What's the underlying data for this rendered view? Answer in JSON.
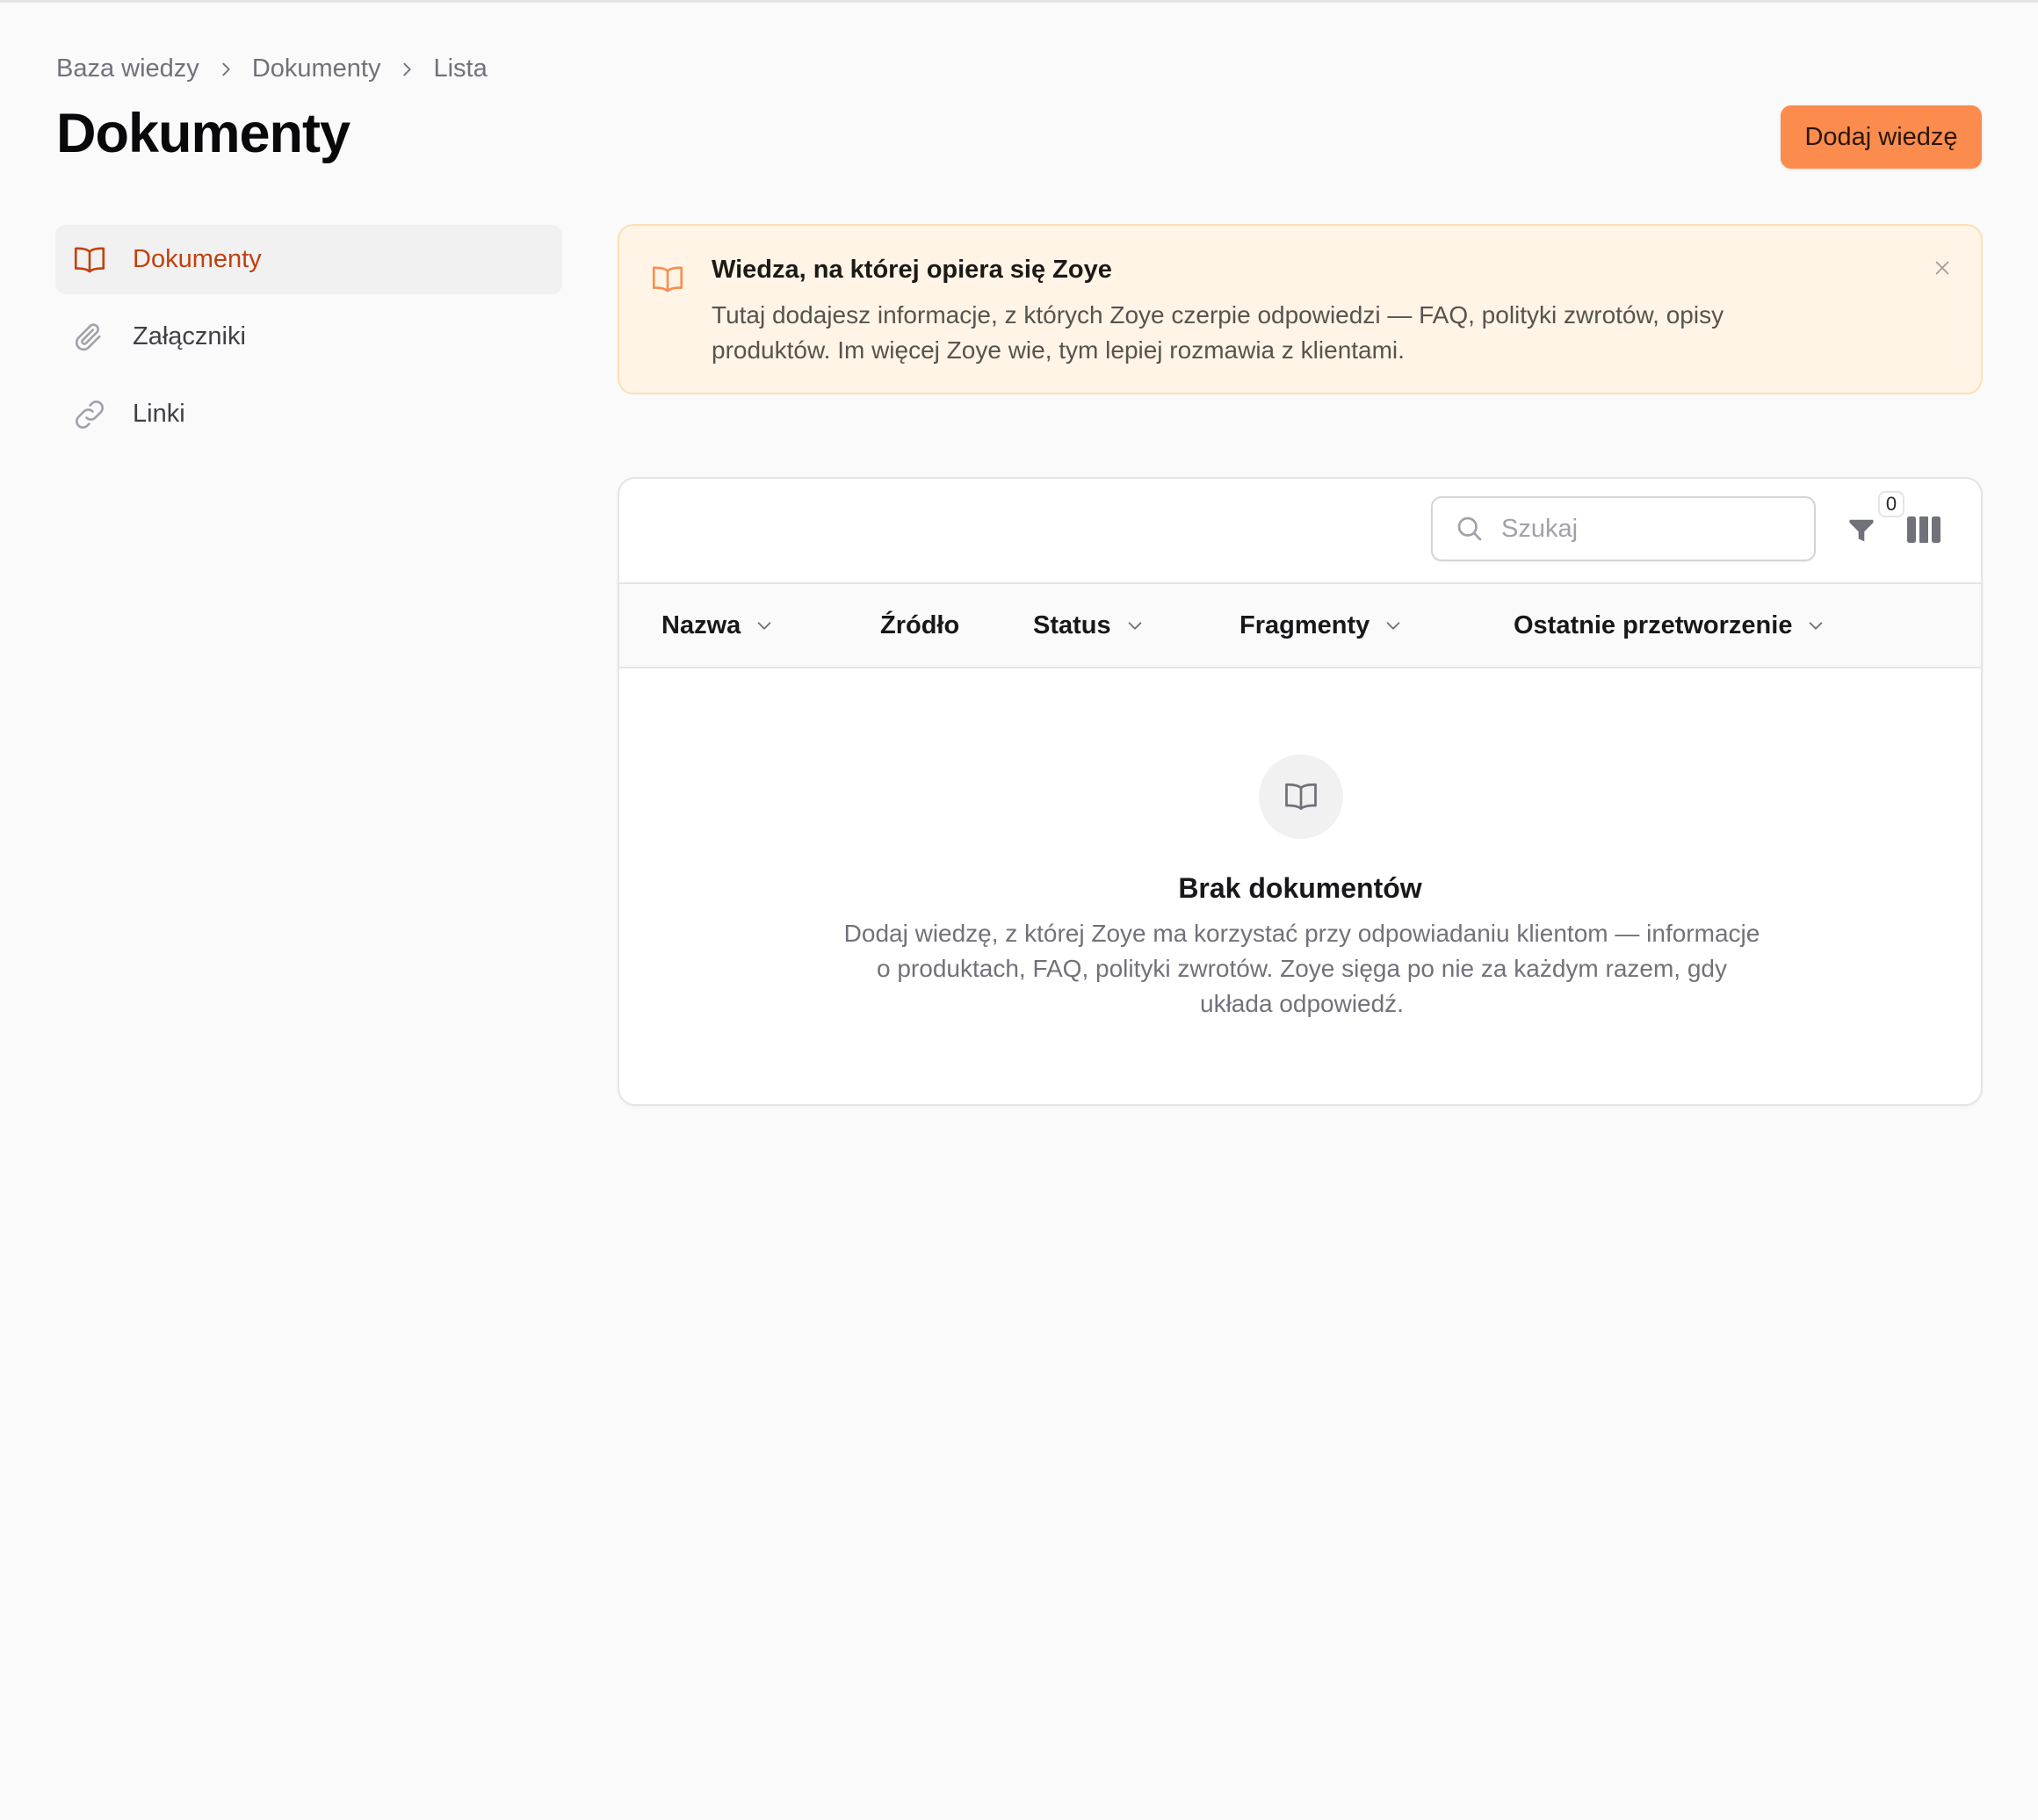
{
  "breadcrumb": [
    "Baza wiedzy",
    "Dokumenty",
    "Lista"
  ],
  "page_title": "Dokumenty",
  "add_button_label": "Dodaj wiedzę",
  "sidebar": {
    "items": [
      {
        "label": "Dokumenty",
        "icon": "book-open-icon",
        "active": true
      },
      {
        "label": "Załączniki",
        "icon": "paperclip-icon",
        "active": false
      },
      {
        "label": "Linki",
        "icon": "link-icon",
        "active": false
      }
    ]
  },
  "banner": {
    "title": "Wiedza, na której opiera się Zoye",
    "text": "Tutaj dodajesz informacje, z których Zoye czerpie odpowiedzi — FAQ, polityki zwrotów, opisy produktów. Im więcej Zoye wie, tym lepiej rozmawia z klientami.",
    "icon": "book-open-icon"
  },
  "table": {
    "search_placeholder": "Szukaj",
    "search_value": "",
    "filter_count": "0",
    "columns": [
      {
        "label": "Nazwa",
        "sortable": true
      },
      {
        "label": "Źródło",
        "sortable": false
      },
      {
        "label": "Status",
        "sortable": true
      },
      {
        "label": "Fragmenty",
        "sortable": true
      },
      {
        "label": "Ostatnie przetworzenie",
        "sortable": true
      }
    ],
    "rows": [],
    "empty_state": {
      "title": "Brak dokumentów",
      "text": "Dodaj wiedzę, z której Zoye ma korzystać przy odpowiadaniu klientom — informacje o produktach, FAQ, polityki zwrotów. Zoye sięga po nie za każdym razem, gdy układa odpowiedź.",
      "icon": "book-open-icon"
    }
  },
  "colors": {
    "accent": "#fb8c4e",
    "active_text": "#c2410c",
    "banner_bg": "#fff4e6",
    "banner_border": "#fde0b5"
  }
}
